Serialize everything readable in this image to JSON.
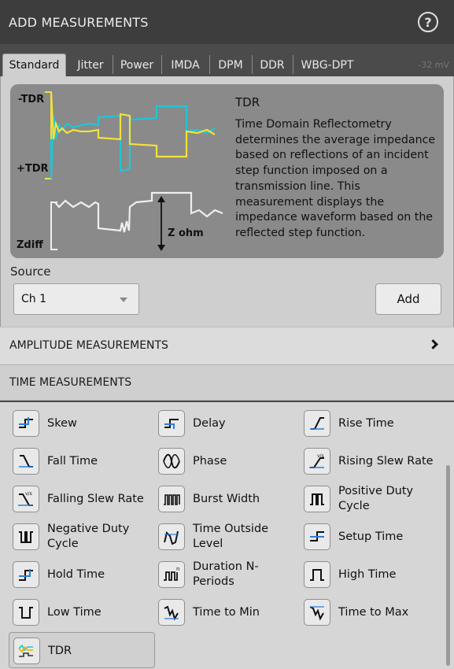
{
  "header": {
    "title": "ADD MEASUREMENTS",
    "help_icon": "help-icon",
    "help_symbol": "?"
  },
  "tabs": [
    {
      "label": "Standard",
      "active": true
    },
    {
      "label": "Jitter"
    },
    {
      "label": "Power"
    },
    {
      "label": "IMDA"
    },
    {
      "label": "DPM"
    },
    {
      "label": "DDR"
    },
    {
      "label": "WBG-DPT"
    }
  ],
  "background_readout": "-32 mV",
  "description": {
    "title": "TDR",
    "text": "Time Domain Reflectometry determines the average impedance based on reflections of an incident step function imposed on a transmission line. This measurement displays the impedance waveform based on the reflected step function.",
    "labels": {
      "neg_tdr": "-TDR",
      "pos_tdr": "+TDR",
      "zdiff": "Zdiff",
      "z_ohm": "Z ohm"
    },
    "colors": {
      "trace_cyan": "#1fc6d6",
      "trace_yellow": "#f3e03c",
      "trace_white": "#eeeeee"
    }
  },
  "source": {
    "label": "Source",
    "value": "Ch 1"
  },
  "add_button": "Add",
  "sections": {
    "amplitude": "AMPLITUDE MEASUREMENTS",
    "time": "TIME MEASUREMENTS"
  },
  "time_measurements": [
    {
      "label": "Skew",
      "icon": "skew-icon"
    },
    {
      "label": "Delay",
      "icon": "delay-icon"
    },
    {
      "label": "Rise Time",
      "icon": "rise-time-icon"
    },
    {
      "label": "Fall Time",
      "icon": "fall-time-icon"
    },
    {
      "label": "Phase",
      "icon": "phase-icon"
    },
    {
      "label": "Rising Slew Rate",
      "icon": "rising-slew-rate-icon"
    },
    {
      "label": "Falling Slew Rate",
      "icon": "falling-slew-rate-icon"
    },
    {
      "label": "Burst Width",
      "icon": "burst-width-icon"
    },
    {
      "label": "Positive Duty Cycle",
      "icon": "positive-duty-cycle-icon"
    },
    {
      "label": "Negative Duty Cycle",
      "icon": "negative-duty-cycle-icon"
    },
    {
      "label": "Time Outside Level",
      "icon": "time-outside-level-icon"
    },
    {
      "label": "Setup Time",
      "icon": "setup-time-icon"
    },
    {
      "label": "Hold Time",
      "icon": "hold-time-icon"
    },
    {
      "label": "Duration N-Periods",
      "icon": "duration-n-periods-icon"
    },
    {
      "label": "High Time",
      "icon": "high-time-icon"
    },
    {
      "label": "Low Time",
      "icon": "low-time-icon"
    },
    {
      "label": "Time to Min",
      "icon": "time-to-min-icon"
    },
    {
      "label": "Time to Max",
      "icon": "time-to-max-icon"
    },
    {
      "label": "TDR",
      "icon": "tdr-icon",
      "selected": true
    }
  ],
  "icon_glyphs": {
    "slew_unit": "v/s",
    "period_n": "n"
  }
}
